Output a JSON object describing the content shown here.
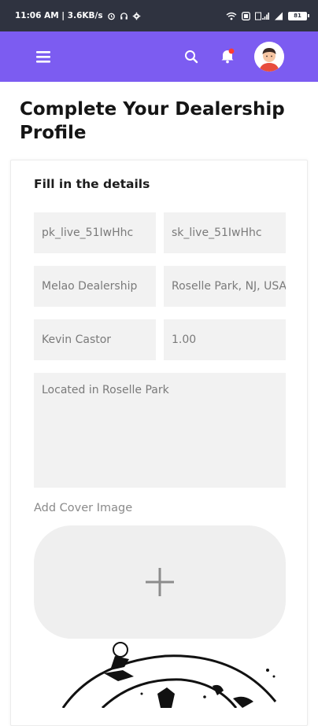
{
  "status_bar": {
    "time_speed": "11:06 AM | 3.6KB/s",
    "battery": "81"
  },
  "app_bar": {
    "menu_icon": "hamburger-menu-icon",
    "search_icon": "search-icon",
    "notification_icon": "bell-icon",
    "notification_dot_color": "#ff3b30",
    "avatar": "user-avatar",
    "brand_color": "#7c5cf1"
  },
  "page": {
    "title": "Complete Your Dealership Profile"
  },
  "form": {
    "section_title": "Fill in the details",
    "publishable_key": "pk_live_51IwHhc",
    "secret_key": "sk_live_51IwHhc",
    "dealership_name": "Melao Dealership",
    "address": "Roselle Park, NJ, USA",
    "contact_name": "Kevin Castor",
    "rating": "1.00",
    "description": "Located in Roselle Park",
    "cover_label": "Add Cover Image",
    "upload_icon": "plus-icon"
  }
}
